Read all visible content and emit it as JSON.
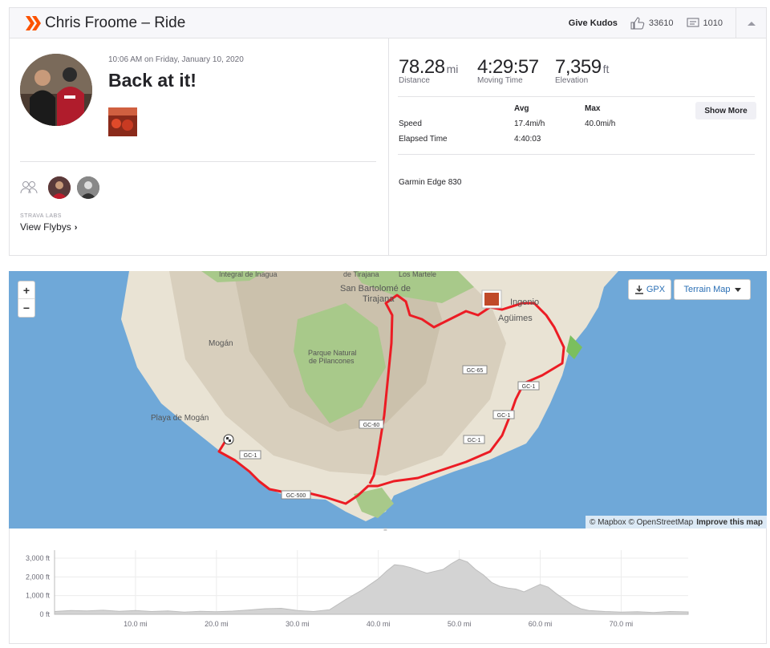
{
  "header": {
    "title": "Chris Froome – Ride",
    "give_kudos": "Give Kudos",
    "kudos_count": "33610",
    "comment_count": "1010"
  },
  "activity": {
    "datetime": "10:06 AM on Friday, January 10, 2020",
    "name": "Back at it!",
    "labs_label": "STRAVA LABS",
    "flybys_label": "View Flybys"
  },
  "stats": {
    "distance": {
      "value": "78.28",
      "unit": "mi",
      "label": "Distance"
    },
    "moving_time": {
      "value": "4:29:57",
      "label": "Moving Time"
    },
    "elevation": {
      "value": "7,359",
      "unit": "ft",
      "label": "Elevation"
    },
    "table": {
      "avg_header": "Avg",
      "max_header": "Max",
      "rows": [
        {
          "label": "Speed",
          "avg": "17.4mi/h",
          "max": "40.0mi/h"
        },
        {
          "label": "Elapsed Time",
          "avg": "4:40:03",
          "max": ""
        }
      ]
    },
    "show_more": "Show More",
    "device": "Garmin Edge 830"
  },
  "map": {
    "zoom_in": "+",
    "zoom_out": "−",
    "gpx_label": "GPX",
    "terrain_label": "Terrain Map",
    "attribution": "© Mapbox © OpenStreetMap",
    "improve": "Improve this map",
    "labels": {
      "inagua": "Integral de Inagua",
      "tirajana": "de Tirajana",
      "martele": "Los Martele",
      "bartolome": "San Bartolomé de",
      "tirajana2": "Tirajana",
      "ingenio": "Ingenio",
      "aguimes": "Agüimes",
      "mogan": "Mogán",
      "parque": "Parque Natural",
      "parque2": "de Pilancones",
      "playa": "Playa de Mogán",
      "gc65": "GC-65",
      "gc1a": "GC-1",
      "gc1b": "GC-1",
      "gc1c": "GC-1",
      "gc1d": "GC-1",
      "gc60": "GC-60",
      "gc500": "GC-500"
    }
  },
  "chart_data": {
    "type": "area",
    "title": "",
    "xlabel": "",
    "ylabel": "",
    "y_ticks": [
      "3,000 ft",
      "2,000 ft",
      "1,000 ft",
      "0 ft"
    ],
    "x_ticks": [
      "10.0 mi",
      "20.0 mi",
      "30.0 mi",
      "40.0 mi",
      "50.0 mi",
      "60.0 mi",
      "70.0 mi"
    ],
    "xlim": [
      0,
      78.28
    ],
    "ylim": [
      0,
      3000
    ],
    "x": [
      0,
      2,
      4,
      6,
      8,
      10,
      12,
      14,
      16,
      18,
      20,
      22,
      24,
      26,
      28,
      30,
      32,
      34,
      36,
      38,
      40,
      41,
      42,
      43,
      44,
      45,
      46,
      47,
      48,
      49,
      50,
      51,
      52,
      53,
      54,
      55,
      56,
      57,
      58,
      59,
      60,
      61,
      62,
      63,
      64,
      65,
      66,
      68,
      70,
      72,
      74,
      76,
      78.28
    ],
    "values": [
      150,
      200,
      180,
      220,
      160,
      200,
      150,
      180,
      120,
      160,
      140,
      170,
      230,
      300,
      320,
      200,
      150,
      250,
      800,
      1300,
      1900,
      2300,
      2650,
      2600,
      2500,
      2350,
      2200,
      2300,
      2400,
      2700,
      2950,
      2800,
      2400,
      2100,
      1700,
      1500,
      1400,
      1350,
      1200,
      1400,
      1600,
      1450,
      1100,
      800,
      500,
      300,
      200,
      150,
      120,
      140,
      100,
      150,
      130
    ],
    "grid": true
  }
}
